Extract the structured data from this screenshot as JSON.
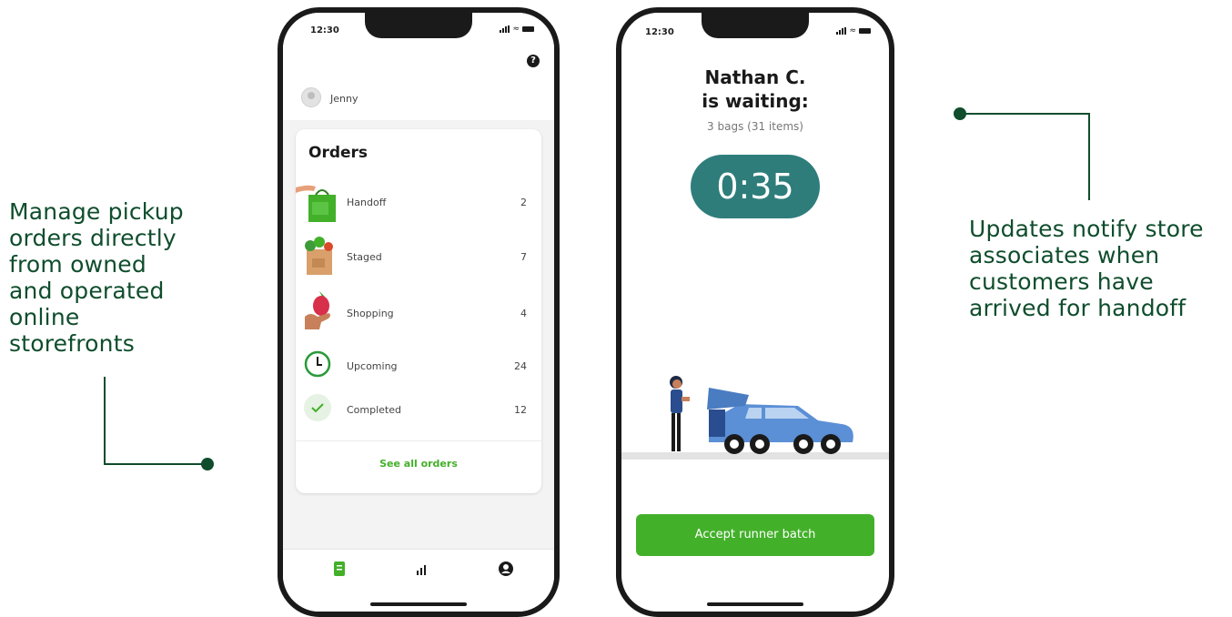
{
  "left_callout": {
    "lines": [
      "Manage pickup",
      "orders directly",
      "from owned",
      "and operated",
      "online",
      "storefronts"
    ]
  },
  "right_callout": {
    "lines": [
      "Updates notify store",
      "associates when",
      "customers have",
      "arrived for handoff"
    ]
  },
  "phone1": {
    "time": "12:30",
    "user_name": "Jenny",
    "orders_title": "Orders",
    "rows": [
      {
        "label": "Handoff",
        "count": "2",
        "icon": "handoff-bag-icon"
      },
      {
        "label": "Staged",
        "count": "7",
        "icon": "staged-grocery-bag-icon"
      },
      {
        "label": "Shopping",
        "count": "4",
        "icon": "shopping-hand-icon"
      },
      {
        "label": "Upcoming",
        "count": "24",
        "icon": "clock-icon"
      },
      {
        "label": "Completed",
        "count": "12",
        "icon": "check-icon"
      }
    ],
    "see_all": "See all orders",
    "tabs": [
      "orders-tab-icon",
      "stats-tab-icon",
      "profile-tab-icon"
    ],
    "help_glyph": "?"
  },
  "phone2": {
    "time": "12:30",
    "customer_name": "Nathan C.",
    "waiting_text": "is waiting:",
    "bags_text": "3 bags (31 items)",
    "timer": "0:35",
    "accept_label": "Accept runner batch"
  },
  "colors": {
    "brand_dark_green": "#0f4d2c",
    "accent_green": "#43b02a",
    "timer_teal": "#2e7d7b",
    "car_blue": "#5b8fd6"
  }
}
